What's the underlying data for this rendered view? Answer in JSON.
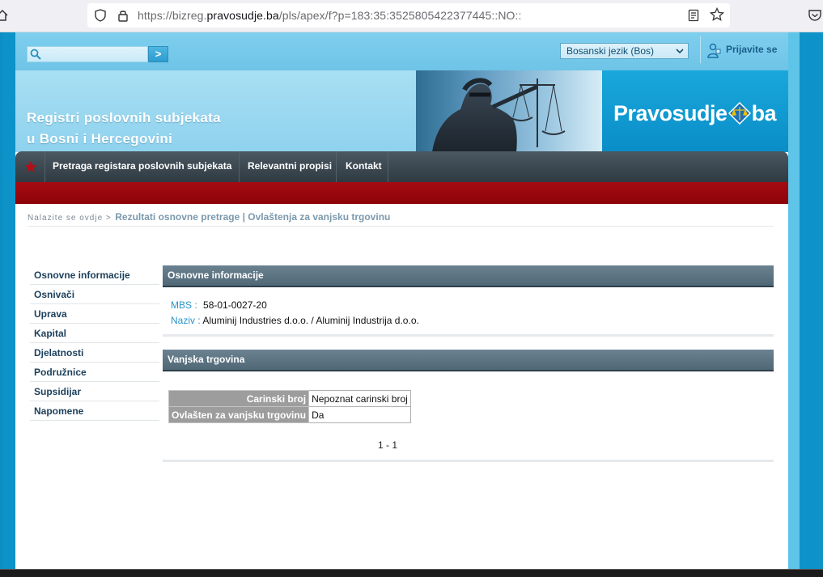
{
  "browser": {
    "url_prefix": "https://bizreg.",
    "url_domain": "pravosudje.ba",
    "url_path": "/pls/apex/f?p=183:35:3525805422377445::NO::"
  },
  "header": {
    "search_placeholder": "",
    "search_go_label": ">",
    "language": "Bosanski jezik (Bos)",
    "login_label": "Prijavite se"
  },
  "banner": {
    "title_line1": "Registri poslovnih subjekata",
    "title_line2": "u Bosni i Hercegovini",
    "brand_left": "Pravosudje",
    "brand_right": "ba"
  },
  "nav": {
    "items": [
      {
        "label": "Pretraga registara poslovnih subjekata"
      },
      {
        "label": "Relevantni propisi"
      },
      {
        "label": "Kontakt"
      }
    ]
  },
  "breadcrumb": {
    "prefix": "Nalazite se ovdje >",
    "current": "Rezultati osnovne pretrage | Ovlaštenja za vanjsku trgovinu"
  },
  "sidebar": {
    "items": [
      {
        "label": "Osnovne informacije"
      },
      {
        "label": "Osnivači"
      },
      {
        "label": "Uprava"
      },
      {
        "label": "Kapital"
      },
      {
        "label": "Djelatnosti"
      },
      {
        "label": "Podružnice"
      },
      {
        "label": "Supsidijar"
      },
      {
        "label": "Napomene"
      }
    ]
  },
  "basic_info": {
    "heading": "Osnovne informacije",
    "mbs_label": "MBS :",
    "mbs_value": "58-01-0027-20",
    "naziv_label": "Naziv :",
    "naziv_value": "Aluminij Industries d.o.o. / Aluminij Industrija d.o.o."
  },
  "foreign_trade": {
    "heading": "Vanjska trgovina",
    "rows": [
      {
        "label": "Carinski broj",
        "value": "Nepoznat carinski broj"
      },
      {
        "label": "Ovlašten za vanjsku trgovinu",
        "value": "Da"
      }
    ],
    "pagination": "1 - 1"
  },
  "colors": {
    "page_blue": "#0e93c9",
    "nav_dark": "#2f3a42",
    "accent_red": "#8c0208",
    "region_header": "#506776",
    "label_blue": "#2a93c8"
  }
}
